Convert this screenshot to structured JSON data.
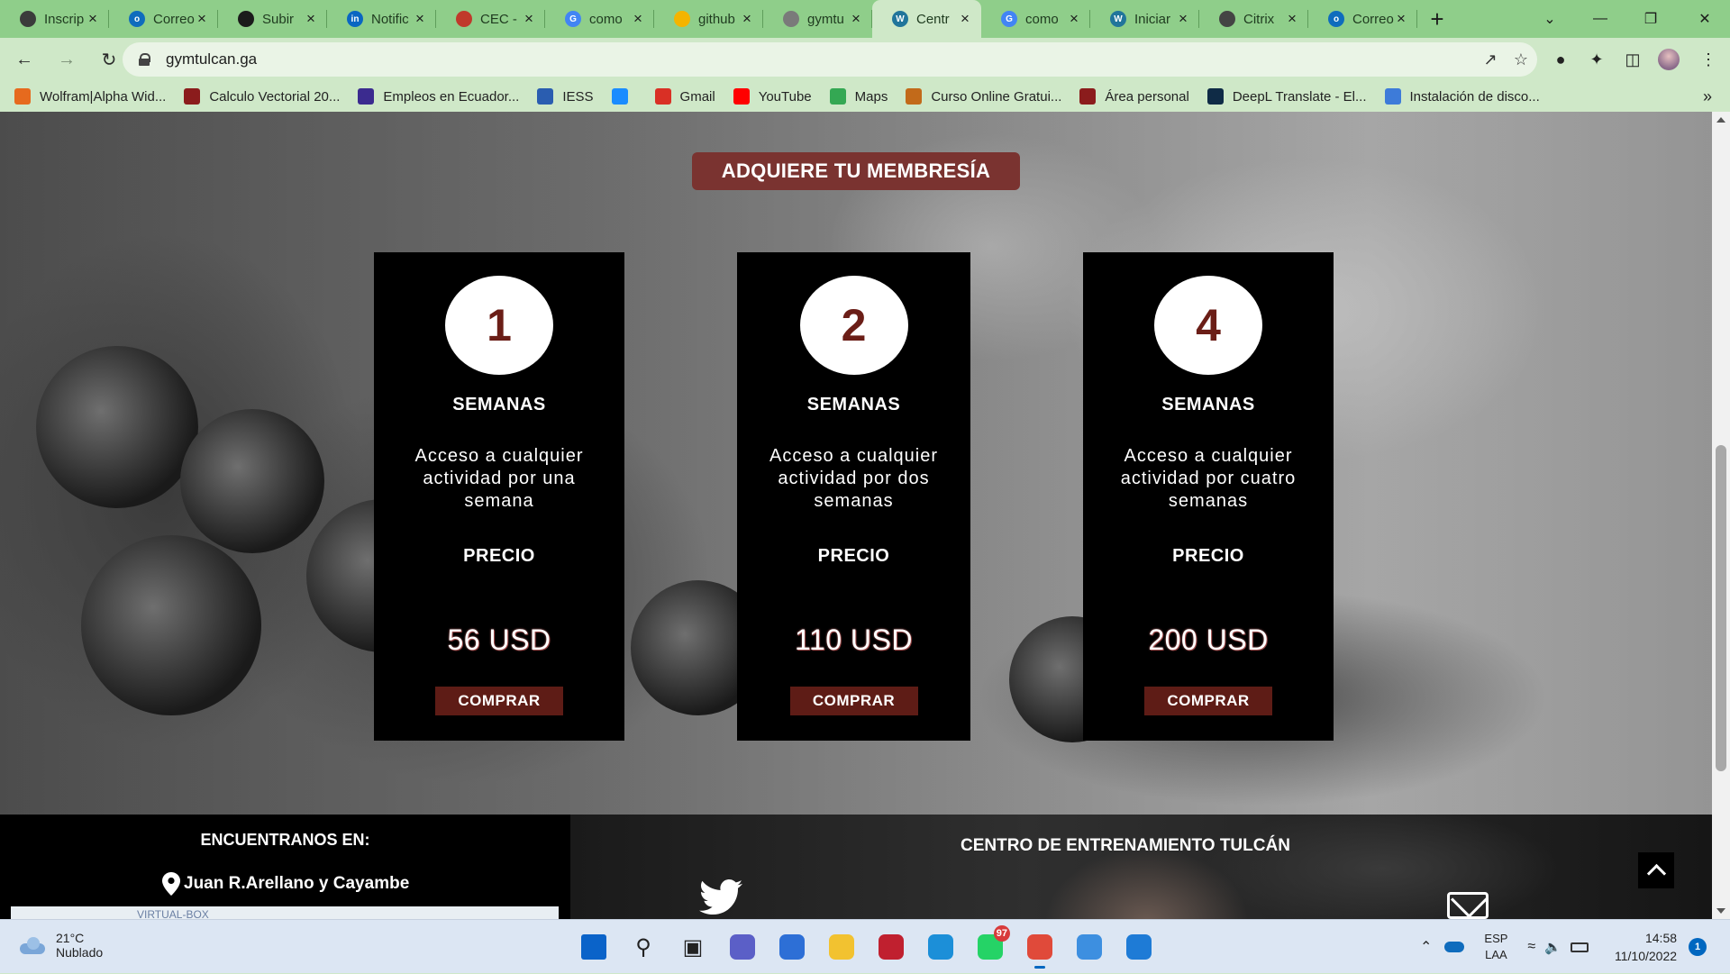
{
  "browser": {
    "tabs": [
      {
        "title": "Inscrip",
        "icon": "globe-icon",
        "color": "#3b3b3b",
        "letter": ""
      },
      {
        "title": "Correo",
        "icon": "outlook-icon",
        "color": "#0f6cbd",
        "letter": "o"
      },
      {
        "title": "Subir",
        "icon": "github-icon",
        "color": "#1b1b1b",
        "letter": ""
      },
      {
        "title": "Notific",
        "icon": "linkedin-icon",
        "color": "#0a66c2",
        "letter": "in"
      },
      {
        "title": "CEC -",
        "icon": "cec-icon",
        "color": "#c0392b",
        "letter": ""
      },
      {
        "title": "como",
        "icon": "google-icon",
        "color": "#4285f4",
        "letter": "G"
      },
      {
        "title": "github",
        "icon": "pencil-icon",
        "color": "#f4b400",
        "letter": ""
      },
      {
        "title": "gymtu",
        "icon": "globe-icon",
        "color": "#7a7a7a",
        "letter": ""
      },
      {
        "title": "Centr",
        "icon": "wordpress-icon",
        "color": "#21759b",
        "letter": "W"
      },
      {
        "title": "como",
        "icon": "google-icon",
        "color": "#4285f4",
        "letter": "G"
      },
      {
        "title": "Iniciar",
        "icon": "wordpress-icon",
        "color": "#21759b",
        "letter": "W"
      },
      {
        "title": "Citrix",
        "icon": "citrix-icon",
        "color": "#444",
        "letter": ""
      },
      {
        "title": "Correo",
        "icon": "outlook-icon",
        "color": "#0f6cbd",
        "letter": "o"
      }
    ],
    "active_tab_index": 8,
    "url": "gymtulcan.ga",
    "bookmarks": [
      {
        "label": "Wolfram|Alpha Wid...",
        "icon": "wolfram-icon",
        "color": "#e66a1e"
      },
      {
        "label": "Calculo Vectorial 20...",
        "icon": "book-icon",
        "color": "#8b1c1c"
      },
      {
        "label": "Empleos en Ecuador...",
        "icon": "chevron-icon",
        "color": "#3b2b8f"
      },
      {
        "label": "IESS",
        "icon": "iess-icon",
        "color": "#2a5db0"
      },
      {
        "label": "",
        "icon": "appstore-icon",
        "color": "#1a8cff"
      },
      {
        "label": "Gmail",
        "icon": "gmail-icon",
        "color": "#d93025"
      },
      {
        "label": "YouTube",
        "icon": "youtube-icon",
        "color": "#ff0000"
      },
      {
        "label": "Maps",
        "icon": "maps-icon",
        "color": "#34a853"
      },
      {
        "label": "Curso Online Gratui...",
        "icon": "course-icon",
        "color": "#c26a1a"
      },
      {
        "label": "Área personal",
        "icon": "moodle-icon",
        "color": "#8b1c1c"
      },
      {
        "label": "DeepL Translate - El...",
        "icon": "deepl-icon",
        "color": "#0f2b46"
      },
      {
        "label": "Instalación de disco...",
        "icon": "disk-icon",
        "color": "#3d7bd9"
      }
    ]
  },
  "page": {
    "membership_title": "ADQUIERE TU MEMBRESÍA",
    "plans": [
      {
        "number": "1",
        "unit": "SEMANAS",
        "description": "Acceso a cualquier actividad por una semana",
        "price_label": "PRECIO",
        "price": "56 USD",
        "button": "COMPRAR"
      },
      {
        "number": "2",
        "unit": "SEMANAS",
        "description": "Acceso a cualquier actividad por dos semanas",
        "price_label": "PRECIO",
        "price": "110 USD",
        "button": "COMPRAR"
      },
      {
        "number": "4",
        "unit": "SEMANAS",
        "description": "Acceso a cualquier actividad por cuatro semanas",
        "price_label": "PRECIO",
        "price": "200 USD",
        "button": "COMPRAR"
      }
    ],
    "footer": {
      "find_us": "ENCUENTRANOS EN:",
      "address": "Juan R.Arellano y Cayambe",
      "map_label": "VIRTUAL-BOX",
      "center_name": "CENTRO DE ENTRENAMIENTO TULCÁN"
    },
    "colors": {
      "accent": "#7a3330",
      "button": "#5e1c16",
      "number": "#6b1e17"
    }
  },
  "taskbar": {
    "temperature": "21°C",
    "condition": "Nublado",
    "apps": [
      {
        "name": "start-icon"
      },
      {
        "name": "search-icon"
      },
      {
        "name": "task-view-icon"
      },
      {
        "name": "teams-icon"
      },
      {
        "name": "store-icon"
      },
      {
        "name": "file-explorer-icon"
      },
      {
        "name": "screen-recorder-icon"
      },
      {
        "name": "edge-icon"
      },
      {
        "name": "whatsapp-icon",
        "badge": "97"
      },
      {
        "name": "chrome-icon"
      },
      {
        "name": "notepad-icon"
      },
      {
        "name": "remote-desktop-icon"
      }
    ],
    "language": "ESP",
    "layout": "LAA",
    "time": "14:58",
    "date": "11/10/2022",
    "notifications": "1"
  }
}
